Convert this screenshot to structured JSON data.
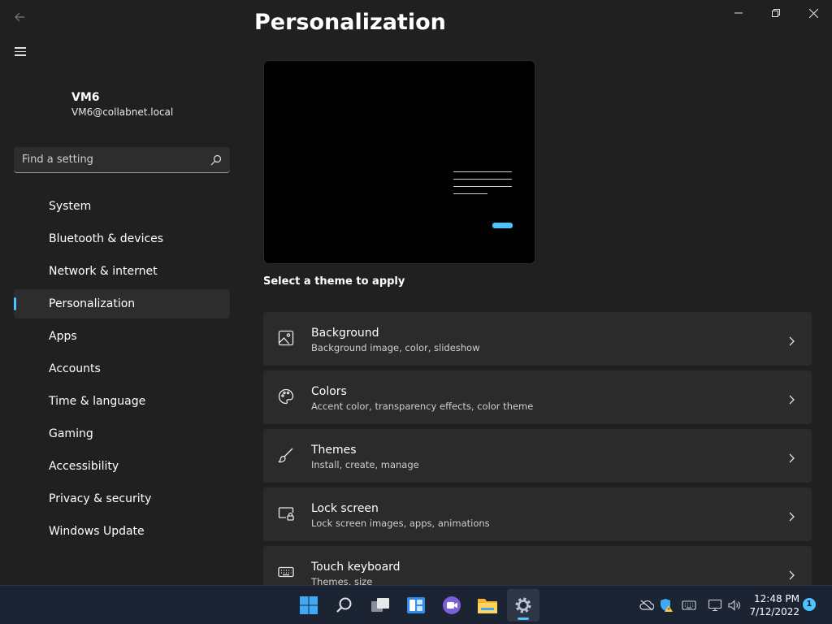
{
  "window": {
    "title": "Personalization"
  },
  "profile": {
    "name": "VM6",
    "email": "VM6@collabnet.local"
  },
  "search": {
    "placeholder": "Find a setting"
  },
  "nav": {
    "items": [
      {
        "label": "System"
      },
      {
        "label": "Bluetooth & devices"
      },
      {
        "label": "Network & internet"
      },
      {
        "label": "Personalization",
        "active": true
      },
      {
        "label": "Apps"
      },
      {
        "label": "Accounts"
      },
      {
        "label": "Time & language"
      },
      {
        "label": "Gaming"
      },
      {
        "label": "Accessibility"
      },
      {
        "label": "Privacy & security"
      },
      {
        "label": "Windows Update"
      }
    ]
  },
  "main": {
    "section_label": "Select a theme to apply",
    "cards": [
      {
        "title": "Background",
        "subtitle": "Background image, color, slideshow",
        "icon": "image-icon"
      },
      {
        "title": "Colors",
        "subtitle": "Accent color, transparency effects, color theme",
        "icon": "palette-icon"
      },
      {
        "title": "Themes",
        "subtitle": "Install, create, manage",
        "icon": "brush-icon"
      },
      {
        "title": "Lock screen",
        "subtitle": "Lock screen images, apps, animations",
        "icon": "lock-screen-icon"
      },
      {
        "title": "Touch keyboard",
        "subtitle": "Themes, size",
        "icon": "keyboard-icon"
      }
    ]
  },
  "taskbar": {
    "time": "12:48 PM",
    "date": "7/12/2022",
    "notification_count": "1"
  },
  "colors": {
    "accent": "#4cc2ff",
    "background": "#202020",
    "card": "#2b2b2b",
    "taskbar": "#1c2433"
  }
}
